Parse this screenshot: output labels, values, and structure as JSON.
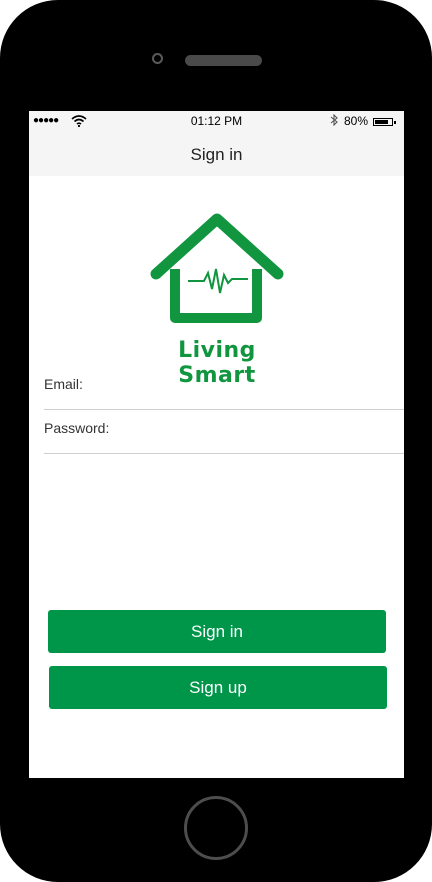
{
  "status_bar": {
    "signal": "●●●●●",
    "time": "01:12 PM",
    "battery_percent": "80%",
    "battery_level": 0.8
  },
  "nav": {
    "title": "Sign in"
  },
  "logo": {
    "text": "Living Smart"
  },
  "form": {
    "email_label": "Email:",
    "email_value": "",
    "password_label": "Password:",
    "password_value": ""
  },
  "buttons": {
    "sign_in": "Sign in",
    "sign_up": "Sign up"
  },
  "colors": {
    "brand_green": "#00964a",
    "logo_green": "#11953f"
  },
  "icons": [
    "wifi-icon",
    "bluetooth-icon",
    "battery-icon",
    "camera-icon",
    "speaker-icon",
    "home-button"
  ]
}
